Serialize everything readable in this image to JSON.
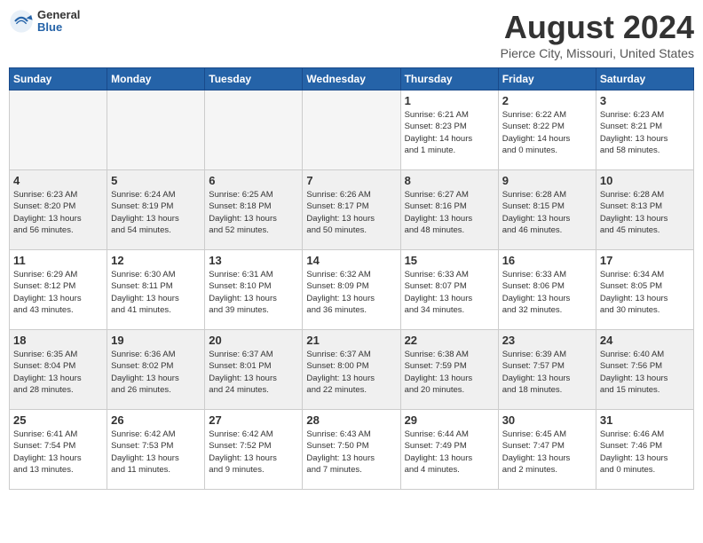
{
  "header": {
    "logo_general": "General",
    "logo_blue": "Blue",
    "month_title": "August 2024",
    "location": "Pierce City, Missouri, United States"
  },
  "weekdays": [
    "Sunday",
    "Monday",
    "Tuesday",
    "Wednesday",
    "Thursday",
    "Friday",
    "Saturday"
  ],
  "weeks": [
    [
      {
        "day": "",
        "info": ""
      },
      {
        "day": "",
        "info": ""
      },
      {
        "day": "",
        "info": ""
      },
      {
        "day": "",
        "info": ""
      },
      {
        "day": "1",
        "info": "Sunrise: 6:21 AM\nSunset: 8:23 PM\nDaylight: 14 hours\nand 1 minute."
      },
      {
        "day": "2",
        "info": "Sunrise: 6:22 AM\nSunset: 8:22 PM\nDaylight: 14 hours\nand 0 minutes."
      },
      {
        "day": "3",
        "info": "Sunrise: 6:23 AM\nSunset: 8:21 PM\nDaylight: 13 hours\nand 58 minutes."
      }
    ],
    [
      {
        "day": "4",
        "info": "Sunrise: 6:23 AM\nSunset: 8:20 PM\nDaylight: 13 hours\nand 56 minutes."
      },
      {
        "day": "5",
        "info": "Sunrise: 6:24 AM\nSunset: 8:19 PM\nDaylight: 13 hours\nand 54 minutes."
      },
      {
        "day": "6",
        "info": "Sunrise: 6:25 AM\nSunset: 8:18 PM\nDaylight: 13 hours\nand 52 minutes."
      },
      {
        "day": "7",
        "info": "Sunrise: 6:26 AM\nSunset: 8:17 PM\nDaylight: 13 hours\nand 50 minutes."
      },
      {
        "day": "8",
        "info": "Sunrise: 6:27 AM\nSunset: 8:16 PM\nDaylight: 13 hours\nand 48 minutes."
      },
      {
        "day": "9",
        "info": "Sunrise: 6:28 AM\nSunset: 8:15 PM\nDaylight: 13 hours\nand 46 minutes."
      },
      {
        "day": "10",
        "info": "Sunrise: 6:28 AM\nSunset: 8:13 PM\nDaylight: 13 hours\nand 45 minutes."
      }
    ],
    [
      {
        "day": "11",
        "info": "Sunrise: 6:29 AM\nSunset: 8:12 PM\nDaylight: 13 hours\nand 43 minutes."
      },
      {
        "day": "12",
        "info": "Sunrise: 6:30 AM\nSunset: 8:11 PM\nDaylight: 13 hours\nand 41 minutes."
      },
      {
        "day": "13",
        "info": "Sunrise: 6:31 AM\nSunset: 8:10 PM\nDaylight: 13 hours\nand 39 minutes."
      },
      {
        "day": "14",
        "info": "Sunrise: 6:32 AM\nSunset: 8:09 PM\nDaylight: 13 hours\nand 36 minutes."
      },
      {
        "day": "15",
        "info": "Sunrise: 6:33 AM\nSunset: 8:07 PM\nDaylight: 13 hours\nand 34 minutes."
      },
      {
        "day": "16",
        "info": "Sunrise: 6:33 AM\nSunset: 8:06 PM\nDaylight: 13 hours\nand 32 minutes."
      },
      {
        "day": "17",
        "info": "Sunrise: 6:34 AM\nSunset: 8:05 PM\nDaylight: 13 hours\nand 30 minutes."
      }
    ],
    [
      {
        "day": "18",
        "info": "Sunrise: 6:35 AM\nSunset: 8:04 PM\nDaylight: 13 hours\nand 28 minutes."
      },
      {
        "day": "19",
        "info": "Sunrise: 6:36 AM\nSunset: 8:02 PM\nDaylight: 13 hours\nand 26 minutes."
      },
      {
        "day": "20",
        "info": "Sunrise: 6:37 AM\nSunset: 8:01 PM\nDaylight: 13 hours\nand 24 minutes."
      },
      {
        "day": "21",
        "info": "Sunrise: 6:37 AM\nSunset: 8:00 PM\nDaylight: 13 hours\nand 22 minutes."
      },
      {
        "day": "22",
        "info": "Sunrise: 6:38 AM\nSunset: 7:59 PM\nDaylight: 13 hours\nand 20 minutes."
      },
      {
        "day": "23",
        "info": "Sunrise: 6:39 AM\nSunset: 7:57 PM\nDaylight: 13 hours\nand 18 minutes."
      },
      {
        "day": "24",
        "info": "Sunrise: 6:40 AM\nSunset: 7:56 PM\nDaylight: 13 hours\nand 15 minutes."
      }
    ],
    [
      {
        "day": "25",
        "info": "Sunrise: 6:41 AM\nSunset: 7:54 PM\nDaylight: 13 hours\nand 13 minutes."
      },
      {
        "day": "26",
        "info": "Sunrise: 6:42 AM\nSunset: 7:53 PM\nDaylight: 13 hours\nand 11 minutes."
      },
      {
        "day": "27",
        "info": "Sunrise: 6:42 AM\nSunset: 7:52 PM\nDaylight: 13 hours\nand 9 minutes."
      },
      {
        "day": "28",
        "info": "Sunrise: 6:43 AM\nSunset: 7:50 PM\nDaylight: 13 hours\nand 7 minutes."
      },
      {
        "day": "29",
        "info": "Sunrise: 6:44 AM\nSunset: 7:49 PM\nDaylight: 13 hours\nand 4 minutes."
      },
      {
        "day": "30",
        "info": "Sunrise: 6:45 AM\nSunset: 7:47 PM\nDaylight: 13 hours\nand 2 minutes."
      },
      {
        "day": "31",
        "info": "Sunrise: 6:46 AM\nSunset: 7:46 PM\nDaylight: 13 hours\nand 0 minutes."
      }
    ]
  ]
}
